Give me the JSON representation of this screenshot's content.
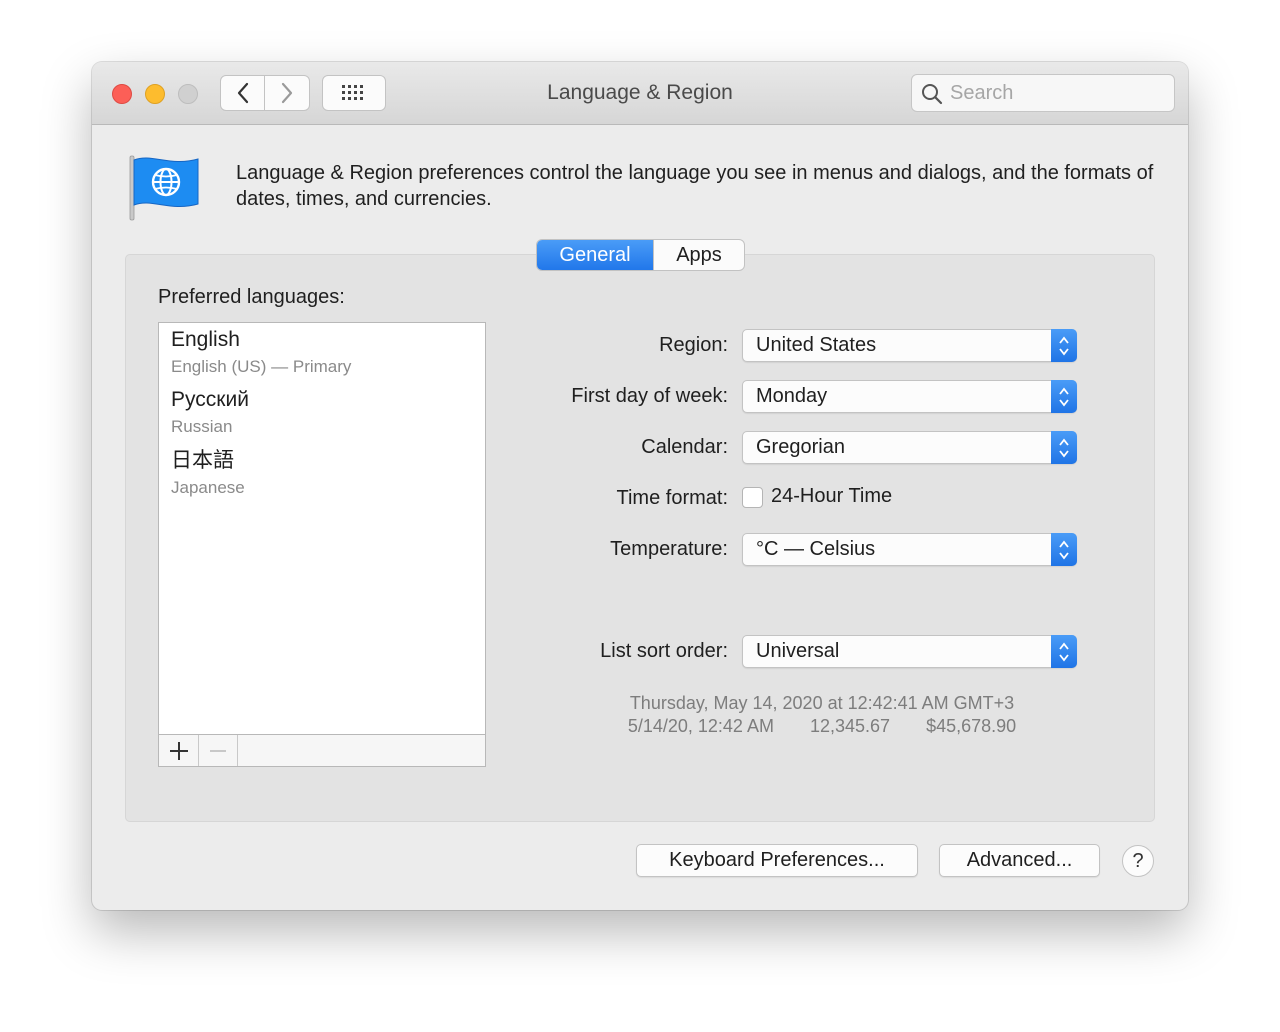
{
  "window": {
    "title": "Language & Region"
  },
  "search": {
    "placeholder": "Search"
  },
  "header": {
    "description": "Language & Region preferences control the language you see in menus and dialogs, and the formats of dates, times, and currencies."
  },
  "tabs": [
    {
      "label": "General",
      "selected": true
    },
    {
      "label": "Apps",
      "selected": false
    }
  ],
  "languages": {
    "label": "Preferred languages:",
    "items": [
      {
        "name": "English",
        "detail": "English (US) — Primary"
      },
      {
        "name": "Русский",
        "detail": "Russian"
      },
      {
        "name": "日本語",
        "detail": "Japanese"
      }
    ],
    "add_label": "+",
    "remove_label": "—"
  },
  "settings": {
    "region": {
      "label": "Region:",
      "value": "United States"
    },
    "first_day": {
      "label": "First day of week:",
      "value": "Monday"
    },
    "calendar": {
      "label": "Calendar:",
      "value": "Gregorian"
    },
    "time_format": {
      "label": "Time format:",
      "checkbox_label": "24-Hour Time",
      "checked": false
    },
    "temperature": {
      "label": "Temperature:",
      "value": "°C — Celsius"
    },
    "sort_order": {
      "label": "List sort order:",
      "value": "Universal"
    }
  },
  "sample": {
    "date_long": "Thursday, May 14, 2020 at 12:42:41 AM GMT+3",
    "date_short": "5/14/20, 12:42 AM",
    "number": "12,345.67",
    "currency": "$45,678.90"
  },
  "buttons": {
    "keyboard": "Keyboard Preferences...",
    "advanced": "Advanced...",
    "help": "?"
  },
  "colors": {
    "accent": "#2177ea",
    "close": "#fc5f57",
    "minimize": "#fdbc2e",
    "zoom_disabled": "#d0d0d0"
  }
}
